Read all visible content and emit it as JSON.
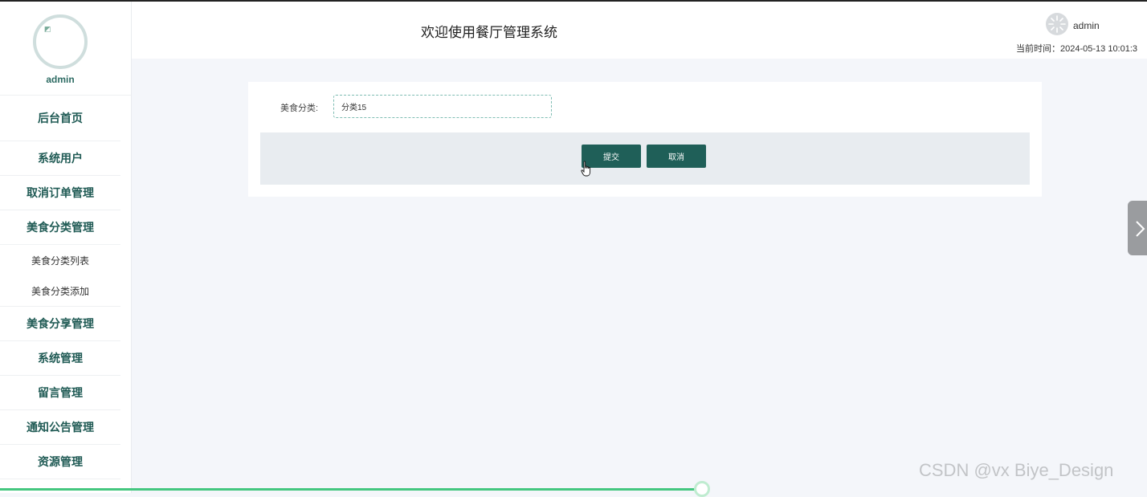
{
  "sidebar": {
    "username": "admin",
    "items": [
      {
        "label": "后台首页"
      },
      {
        "label": "系统用户"
      },
      {
        "label": "取消订单管理"
      },
      {
        "label": "美食分类管理"
      },
      {
        "label": "美食分享管理"
      },
      {
        "label": "系统管理"
      },
      {
        "label": "留言管理"
      },
      {
        "label": "通知公告管理"
      },
      {
        "label": "资源管理"
      }
    ],
    "subitems": [
      {
        "label": "美食分类列表"
      },
      {
        "label": "美食分类添加"
      }
    ]
  },
  "header": {
    "title": "欢迎使用餐厅管理系统",
    "username": "admin",
    "time": "当前时间：2024-05-13 10:01:3"
  },
  "form": {
    "category_label": "美食分类:",
    "category_value": "分类15",
    "submit_label": "提交",
    "cancel_label": "取消"
  },
  "watermark": "CSDN @vx Biye_Design",
  "icons": {
    "side_toggle": "chevron-right-icon",
    "cursor": "hand-pointer-icon",
    "avatar_loading": "spinner-icon"
  },
  "colors": {
    "accent": "#1f5f58",
    "sidebar_text": "#1f5a54",
    "progress": "#44c77f"
  }
}
